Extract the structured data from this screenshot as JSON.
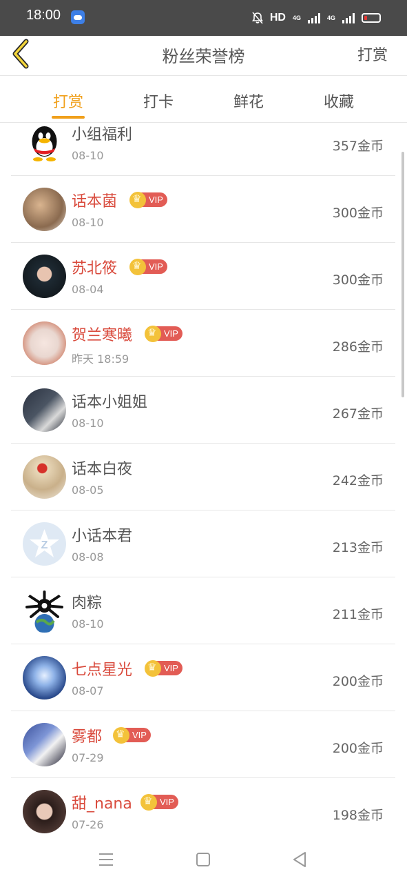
{
  "status_bar": {
    "time": "18:00",
    "hd_label": "HD",
    "network_1": "4G",
    "network_2": "4G",
    "icons": [
      "cloud-app-icon",
      "bell-off-icon",
      "signal-icon",
      "battery-low-icon"
    ]
  },
  "header": {
    "title": "粉丝荣誉榜",
    "action_label": "打赏",
    "back_icon": "chevron-left-icon"
  },
  "tabs": [
    {
      "label": "打赏",
      "active": true
    },
    {
      "label": "打卡",
      "active": false
    },
    {
      "label": "鲜花",
      "active": false
    },
    {
      "label": "收藏",
      "active": false
    }
  ],
  "vip_label": "VIP",
  "accent_color": "#f0a01c",
  "vip_name_color": "#d94a3c",
  "fans": [
    {
      "name": "小组福利",
      "date": "08-10",
      "amount": "357金币",
      "vip": false
    },
    {
      "name": "话本菌",
      "date": "08-10",
      "amount": "300金币",
      "vip": true
    },
    {
      "name": "苏北筱",
      "date": "08-04",
      "amount": "300金币",
      "vip": true
    },
    {
      "name": "贺兰寒曦",
      "date": "昨天 18:59",
      "amount": "286金币",
      "vip": true
    },
    {
      "name": "话本小姐姐",
      "date": "08-10",
      "amount": "267金币",
      "vip": false
    },
    {
      "name": "话本白夜",
      "date": "08-05",
      "amount": "242金币",
      "vip": false
    },
    {
      "name": "小话本君",
      "date": "08-08",
      "amount": "213金币",
      "vip": false
    },
    {
      "name": "肉粽",
      "date": "08-10",
      "amount": "211金币",
      "vip": false
    },
    {
      "name": "七点星光",
      "date": "08-07",
      "amount": "200金币",
      "vip": true
    },
    {
      "name": "雾都",
      "date": "07-29",
      "amount": "200金币",
      "vip": true
    },
    {
      "name": "甜_nana",
      "date": "07-26",
      "amount": "198金币",
      "vip": true
    }
  ],
  "nav_bar": {
    "icons": [
      "menu-icon",
      "home-square-icon",
      "back-triangle-icon"
    ]
  }
}
